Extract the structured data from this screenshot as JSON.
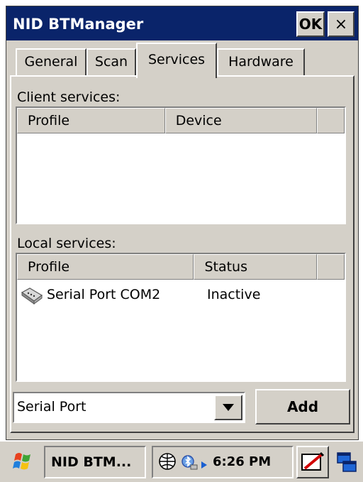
{
  "window": {
    "title": "NID BTManager",
    "ok_label": "OK",
    "close_label": "×"
  },
  "tabs": [
    {
      "label": "General",
      "selected": false
    },
    {
      "label": "Scan",
      "selected": false
    },
    {
      "label": "Services",
      "selected": true
    },
    {
      "label": "Hardware",
      "selected": false
    }
  ],
  "client_services": {
    "label": "Client services:",
    "columns": [
      "Profile",
      "Device"
    ],
    "rows": []
  },
  "local_services": {
    "label": "Local services:",
    "columns": [
      "Profile",
      "Status"
    ],
    "rows": [
      {
        "profile": "Serial Port COM2",
        "status": "Inactive",
        "icon": "serial-port-icon"
      }
    ]
  },
  "service_select": {
    "value": "Serial Port",
    "icon": "chevron-down-icon"
  },
  "add_button": {
    "label": "Add"
  },
  "taskbar": {
    "start_icon": "windows-flag-icon",
    "app_label": "NID BTM...",
    "tray_icons": [
      "network-icon",
      "bluetooth-icon",
      "arrow-right-icon"
    ],
    "clock": "6:26 PM",
    "right_icons": [
      "input-panel-icon",
      "desktop-icon"
    ]
  },
  "colors": {
    "title_bar": "#0a246a",
    "face": "#d4d0c8",
    "title_text": "#ffffff"
  }
}
